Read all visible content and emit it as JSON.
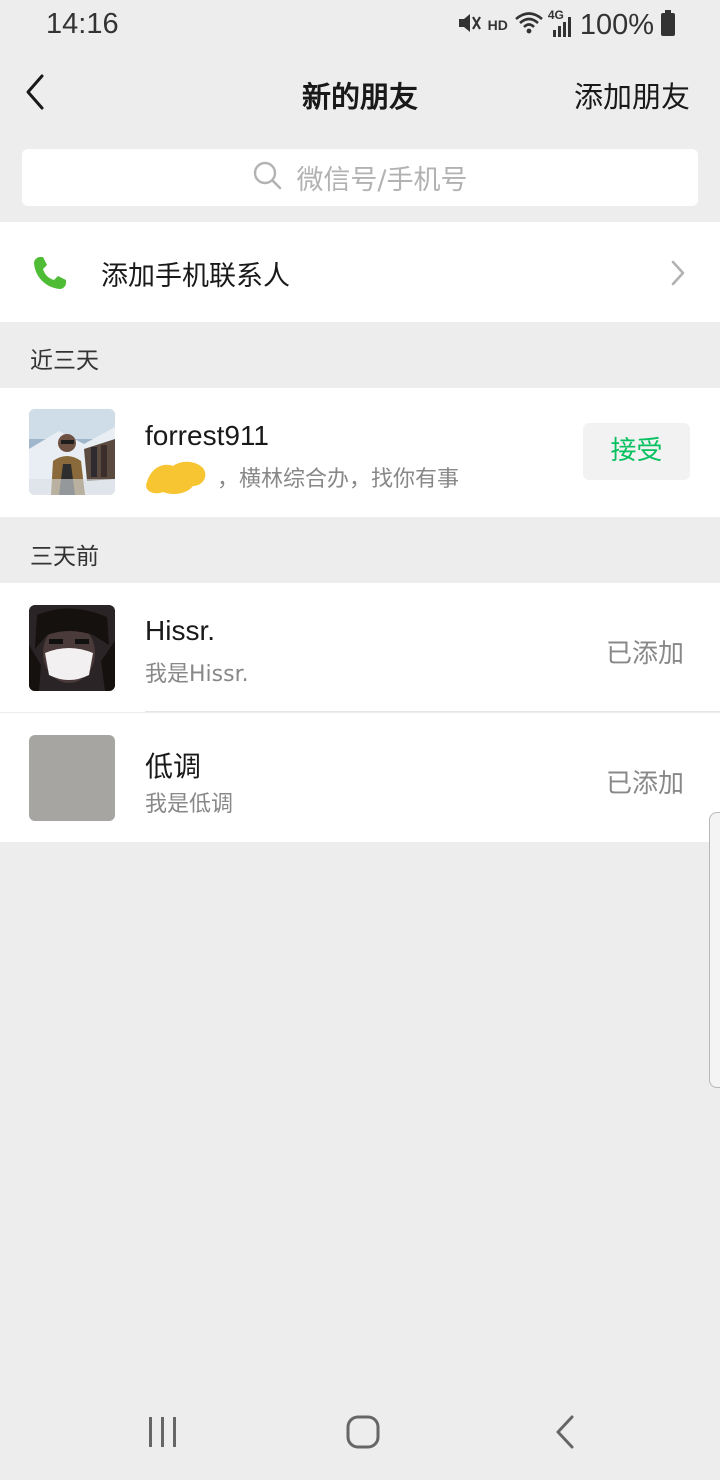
{
  "status_bar": {
    "time": "14:16",
    "hd_label": "HD",
    "network_label": "4G",
    "battery_text": "100%",
    "icons": [
      "mute-icon",
      "wifi-icon",
      "signal-icon",
      "battery-icon"
    ]
  },
  "nav": {
    "title": "新的朋友",
    "action_label": "添加朋友"
  },
  "search": {
    "placeholder": "微信号/手机号"
  },
  "add_phone_contacts": {
    "label": "添加手机联系人",
    "icon_color": "#4fbc35"
  },
  "sections": [
    {
      "header": "近三天",
      "friends": [
        {
          "name": "forrest911",
          "message": "，横林综合办，找你有事",
          "action_label": "接受"
        }
      ]
    },
    {
      "header": "三天前",
      "friends": [
        {
          "name": "Hissr.",
          "message": "我是Hissr.",
          "status": "已添加"
        },
        {
          "name": "低调",
          "message": "我是低调",
          "status": "已添加"
        }
      ]
    }
  ],
  "colors": {
    "accent_green": "#07c160",
    "background": "#ededed"
  }
}
